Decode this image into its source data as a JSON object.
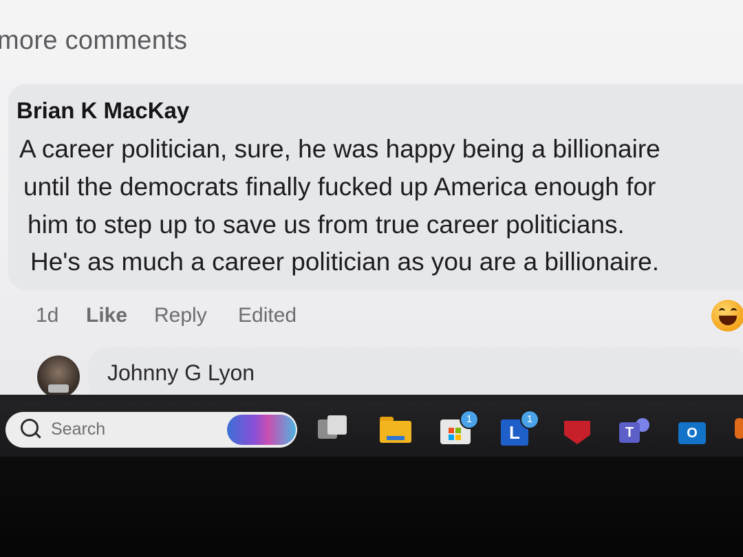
{
  "header": {
    "more_comments": "more comments"
  },
  "comment": {
    "author": "Brian K MacKay",
    "lines": [
      "A career politician, sure, he was happy being a billionaire",
      "until the democrats finally fucked up America enough for",
      "him to step up to save us from true career politicians.",
      "He's as much a career politician as you are a billionaire."
    ],
    "actions": {
      "time": "1d",
      "like": "Like",
      "reply": "Reply",
      "edited": "Edited"
    },
    "reaction_icon": "laughing-emoji-icon"
  },
  "reply": {
    "author": "Johnny G Lyon"
  },
  "taskbar": {
    "search_placeholder": "Search",
    "icons": [
      {
        "name": "task-view-icon"
      },
      {
        "name": "file-explorer-icon"
      },
      {
        "name": "store-icon",
        "badge": "1"
      },
      {
        "name": "l-app-icon",
        "letter": "L",
        "badge": "1"
      },
      {
        "name": "security-shield-icon"
      },
      {
        "name": "teams-icon",
        "letter": "T"
      },
      {
        "name": "outlook-icon",
        "letter": "O"
      }
    ]
  },
  "colors": {
    "bubble": "#e6e7ea",
    "text": "#1d1d1f",
    "muted": "#6c6c70",
    "taskbar": "#1f1f22"
  }
}
